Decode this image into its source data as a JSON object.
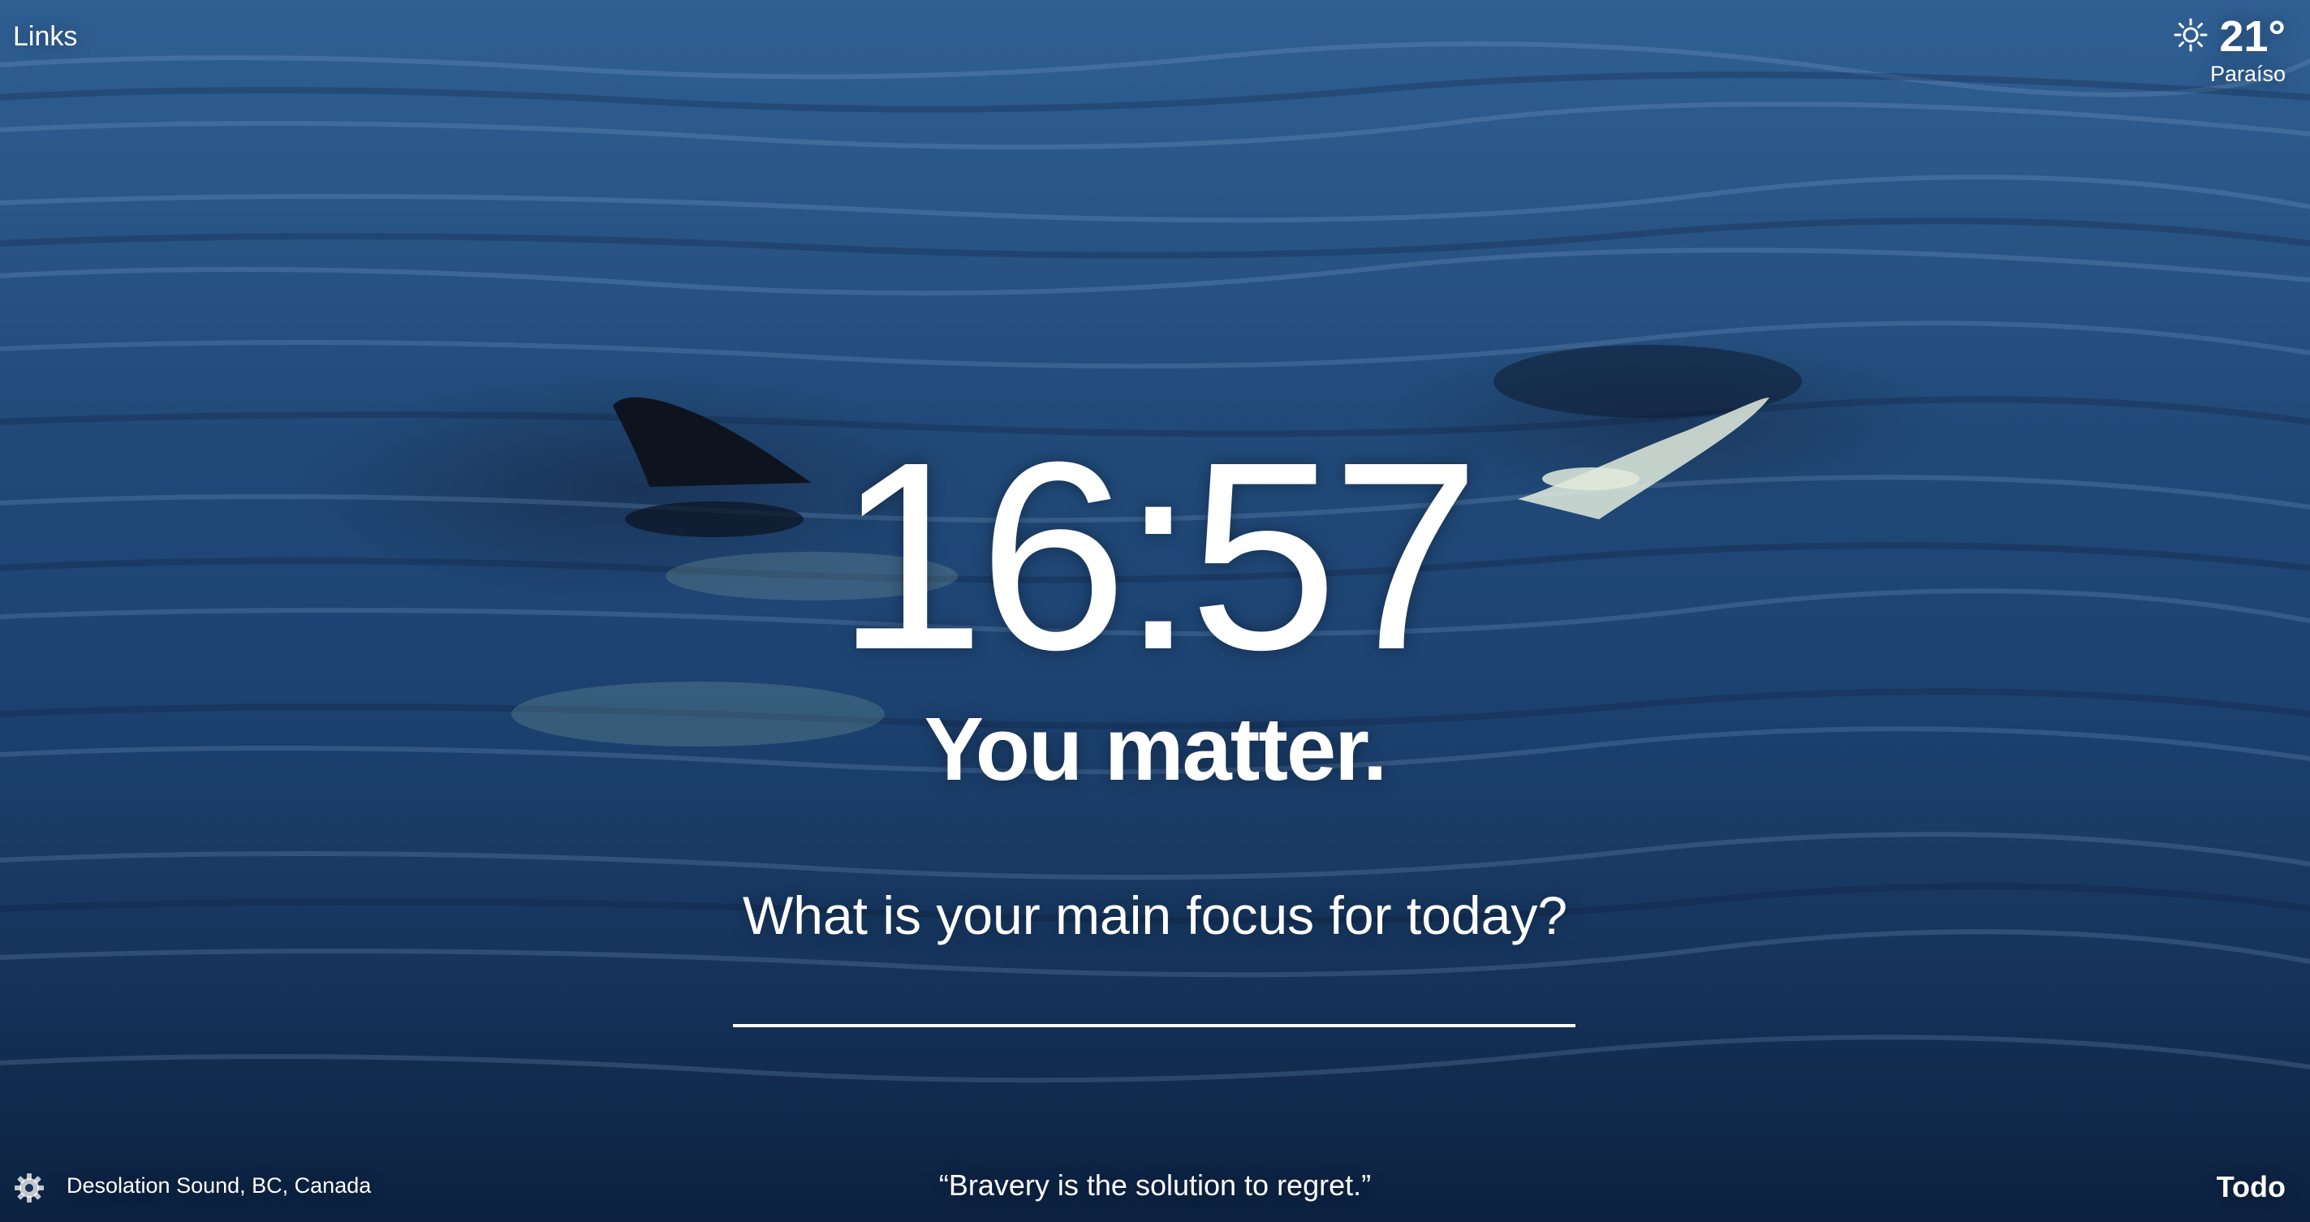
{
  "top_left": {
    "links_label": "Links"
  },
  "weather": {
    "icon": "sun-icon",
    "temperature": "21°",
    "location": "Paraíso"
  },
  "center": {
    "time": "16:57",
    "greeting": "You matter.",
    "focus_question": "What is your main focus for today?",
    "focus_input_value": ""
  },
  "bottom": {
    "settings_icon": "gear-icon",
    "photo_location": "Desolation Sound, BC, Canada",
    "quote": "“Bravery is the solution to regret.”",
    "todo_label": "Todo"
  },
  "colors": {
    "text": "#ffffff",
    "water_top": "#2f5f93",
    "water_bottom": "#0c2140"
  }
}
